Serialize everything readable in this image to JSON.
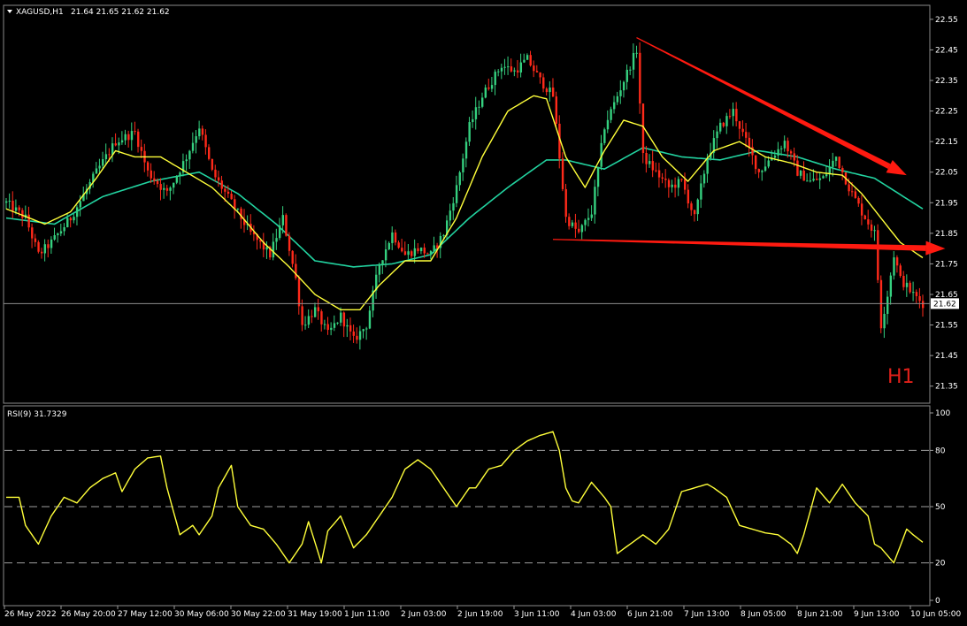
{
  "header": {
    "symbol": "XAGUSD,H1",
    "ohlc": "21.64 21.65 21.62 21.62",
    "timeframe_label": "H1"
  },
  "rsi_header": "RSI(9) 31.7329",
  "price_tag": "21.62",
  "colors": {
    "bull": "#35d07f",
    "bear": "#ff2a1a",
    "ma_fast": "#ffff3a",
    "ma_slow": "#22d3a0",
    "rsi": "#ffff3a",
    "arrow": "#ff1a10",
    "grid": "#9a9a9a"
  },
  "chart_data": [
    {
      "type": "candlestick",
      "ylim": [
        21.3,
        22.59
      ],
      "yticks": [
        "22.55",
        "22.45",
        "22.35",
        "22.25",
        "22.15",
        "22.05",
        "21.95",
        "21.85",
        "21.75",
        "21.65",
        "21.55",
        "21.45",
        "21.35"
      ],
      "xticks": [
        "26 May 2022",
        "26 May 20:00",
        "27 May 12:00",
        "30 May 06:00",
        "30 May 22:00",
        "31 May 19:00",
        "1 Jun 11:00",
        "2 Jun 03:00",
        "2 Jun 19:00",
        "3 Jun 11:00",
        "4 Jun 03:00",
        "6 Jun 21:00",
        "7 Jun 13:00",
        "8 Jun 05:00",
        "8 Jun 21:00",
        "9 Jun 13:00",
        "10 Jun 05:00"
      ],
      "last_price": 21.62,
      "close_path": [
        [
          0,
          21.95
        ],
        [
          6,
          21.9
        ],
        [
          10,
          21.78
        ],
        [
          14,
          21.82
        ],
        [
          20,
          21.9
        ],
        [
          28,
          22.05
        ],
        [
          34,
          22.15
        ],
        [
          40,
          22.18
        ],
        [
          44,
          22.05
        ],
        [
          50,
          21.98
        ],
        [
          56,
          22.1
        ],
        [
          60,
          22.2
        ],
        [
          64,
          22.05
        ],
        [
          70,
          21.95
        ],
        [
          76,
          21.85
        ],
        [
          82,
          21.78
        ],
        [
          86,
          21.9
        ],
        [
          90,
          21.7
        ],
        [
          92,
          21.55
        ],
        [
          96,
          21.6
        ],
        [
          100,
          21.52
        ],
        [
          104,
          21.58
        ],
        [
          108,
          21.5
        ],
        [
          112,
          21.55
        ],
        [
          116,
          21.75
        ],
        [
          120,
          21.85
        ],
        [
          124,
          21.78
        ],
        [
          128,
          21.8
        ],
        [
          132,
          21.78
        ],
        [
          136,
          21.85
        ],
        [
          140,
          22.0
        ],
        [
          144,
          22.2
        ],
        [
          148,
          22.3
        ],
        [
          154,
          22.4
        ],
        [
          158,
          22.38
        ],
        [
          162,
          22.42
        ],
        [
          166,
          22.35
        ],
        [
          170,
          22.3
        ],
        [
          174,
          21.9
        ],
        [
          178,
          21.85
        ],
        [
          182,
          21.92
        ],
        [
          186,
          22.2
        ],
        [
          190,
          22.3
        ],
        [
          194,
          22.4
        ],
        [
          196,
          22.45
        ],
        [
          198,
          22.1
        ],
        [
          202,
          22.05
        ],
        [
          206,
          22.0
        ],
        [
          210,
          22.02
        ],
        [
          214,
          21.9
        ],
        [
          218,
          22.1
        ],
        [
          222,
          22.2
        ],
        [
          226,
          22.25
        ],
        [
          230,
          22.15
        ],
        [
          234,
          22.05
        ],
        [
          238,
          22.1
        ],
        [
          242,
          22.15
        ],
        [
          246,
          22.05
        ],
        [
          250,
          22.02
        ],
        [
          254,
          22.03
        ],
        [
          258,
          22.1
        ],
        [
          262,
          22.0
        ],
        [
          266,
          21.92
        ],
        [
          270,
          21.85
        ],
        [
          272,
          21.55
        ],
        [
          274,
          21.65
        ],
        [
          276,
          21.78
        ],
        [
          278,
          21.7
        ],
        [
          282,
          21.65
        ],
        [
          285,
          21.62
        ]
      ],
      "ma_fast_path": [
        [
          0,
          21.93
        ],
        [
          12,
          21.88
        ],
        [
          20,
          21.92
        ],
        [
          28,
          22.03
        ],
        [
          34,
          22.12
        ],
        [
          40,
          22.1
        ],
        [
          48,
          22.1
        ],
        [
          56,
          22.05
        ],
        [
          64,
          22.0
        ],
        [
          72,
          21.92
        ],
        [
          80,
          21.82
        ],
        [
          88,
          21.74
        ],
        [
          96,
          21.65
        ],
        [
          104,
          21.6
        ],
        [
          110,
          21.6
        ],
        [
          116,
          21.68
        ],
        [
          124,
          21.76
        ],
        [
          132,
          21.76
        ],
        [
          140,
          21.9
        ],
        [
          148,
          22.1
        ],
        [
          156,
          22.25
        ],
        [
          164,
          22.3
        ],
        [
          168,
          22.29
        ],
        [
          174,
          22.1
        ],
        [
          180,
          22.0
        ],
        [
          186,
          22.12
        ],
        [
          192,
          22.22
        ],
        [
          198,
          22.2
        ],
        [
          204,
          22.1
        ],
        [
          212,
          22.02
        ],
        [
          220,
          22.12
        ],
        [
          228,
          22.15
        ],
        [
          236,
          22.1
        ],
        [
          244,
          22.08
        ],
        [
          252,
          22.05
        ],
        [
          260,
          22.04
        ],
        [
          266,
          21.98
        ],
        [
          272,
          21.9
        ],
        [
          278,
          21.82
        ],
        [
          285,
          21.77
        ]
      ],
      "ma_slow_path": [
        [
          0,
          21.9
        ],
        [
          15,
          21.88
        ],
        [
          30,
          21.97
        ],
        [
          45,
          22.02
        ],
        [
          60,
          22.05
        ],
        [
          72,
          21.98
        ],
        [
          84,
          21.88
        ],
        [
          96,
          21.76
        ],
        [
          108,
          21.74
        ],
        [
          120,
          21.75
        ],
        [
          132,
          21.78
        ],
        [
          144,
          21.9
        ],
        [
          156,
          22.0
        ],
        [
          168,
          22.09
        ],
        [
          174,
          22.09
        ],
        [
          186,
          22.06
        ],
        [
          198,
          22.13
        ],
        [
          210,
          22.1
        ],
        [
          222,
          22.09
        ],
        [
          234,
          22.12
        ],
        [
          246,
          22.1
        ],
        [
          258,
          22.06
        ],
        [
          270,
          22.03
        ],
        [
          285,
          21.93
        ]
      ],
      "arrows": [
        {
          "from": [
            196,
            22.49
          ],
          "to": [
            280,
            22.04
          ]
        },
        {
          "from": [
            170,
            21.83
          ],
          "to": [
            292,
            21.8
          ]
        }
      ]
    },
    {
      "type": "line",
      "name": "RSI(9)",
      "ylim": [
        0,
        100
      ],
      "yticks": [
        "100",
        "80",
        "50",
        "20",
        "0"
      ],
      "levels": [
        80,
        50,
        20
      ],
      "path": [
        [
          0,
          55
        ],
        [
          4,
          55
        ],
        [
          6,
          40
        ],
        [
          10,
          30
        ],
        [
          14,
          45
        ],
        [
          18,
          55
        ],
        [
          22,
          52
        ],
        [
          26,
          60
        ],
        [
          30,
          65
        ],
        [
          34,
          68
        ],
        [
          36,
          58
        ],
        [
          40,
          70
        ],
        [
          44,
          76
        ],
        [
          48,
          77
        ],
        [
          50,
          60
        ],
        [
          54,
          35
        ],
        [
          58,
          40
        ],
        [
          60,
          35
        ],
        [
          64,
          45
        ],
        [
          66,
          60
        ],
        [
          70,
          72
        ],
        [
          72,
          50
        ],
        [
          76,
          40
        ],
        [
          80,
          38
        ],
        [
          84,
          30
        ],
        [
          88,
          20
        ],
        [
          92,
          30
        ],
        [
          94,
          42
        ],
        [
          98,
          20
        ],
        [
          100,
          37
        ],
        [
          104,
          45
        ],
        [
          108,
          28
        ],
        [
          112,
          35
        ],
        [
          116,
          45
        ],
        [
          120,
          55
        ],
        [
          124,
          70
        ],
        [
          128,
          75
        ],
        [
          132,
          70
        ],
        [
          136,
          60
        ],
        [
          138,
          55
        ],
        [
          140,
          50
        ],
        [
          144,
          60
        ],
        [
          146,
          60
        ],
        [
          150,
          70
        ],
        [
          154,
          72
        ],
        [
          158,
          80
        ],
        [
          162,
          85
        ],
        [
          166,
          88
        ],
        [
          170,
          90
        ],
        [
          172,
          80
        ],
        [
          174,
          60
        ],
        [
          176,
          53
        ],
        [
          178,
          52
        ],
        [
          182,
          63
        ],
        [
          186,
          55
        ],
        [
          188,
          50
        ],
        [
          190,
          25
        ],
        [
          194,
          30
        ],
        [
          198,
          35
        ],
        [
          202,
          30
        ],
        [
          206,
          38
        ],
        [
          208,
          48
        ],
        [
          210,
          58
        ],
        [
          214,
          60
        ],
        [
          218,
          62
        ],
        [
          220,
          60
        ],
        [
          224,
          55
        ],
        [
          228,
          40
        ],
        [
          232,
          38
        ],
        [
          236,
          36
        ],
        [
          240,
          35
        ],
        [
          244,
          30
        ],
        [
          246,
          25
        ],
        [
          248,
          35
        ],
        [
          252,
          60
        ],
        [
          256,
          52
        ],
        [
          260,
          62
        ],
        [
          264,
          52
        ],
        [
          268,
          45
        ],
        [
          270,
          30
        ],
        [
          272,
          28
        ],
        [
          276,
          20
        ],
        [
          280,
          38
        ],
        [
          282,
          35
        ],
        [
          285,
          31
        ]
      ]
    }
  ]
}
